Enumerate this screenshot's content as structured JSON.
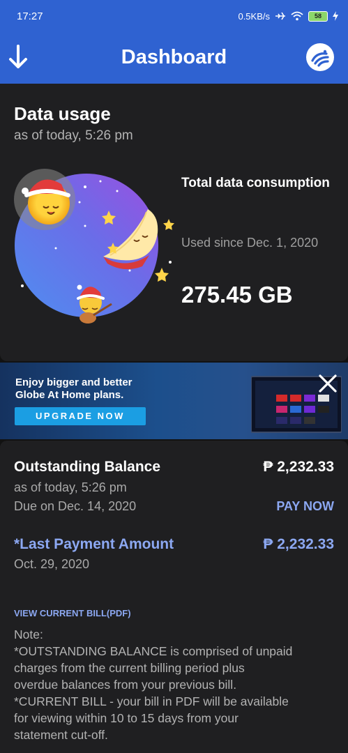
{
  "status_bar": {
    "time": "17:27",
    "network_speed": "0.5KB/s",
    "battery": "58"
  },
  "header": {
    "title": "Dashboard",
    "back_icon": "arrow-down-icon",
    "logo_icon": "globe-logo-icon"
  },
  "data_usage": {
    "title": "Data usage",
    "as_of": "as of today, 5:26 pm",
    "consumption_label": "Total data consumption",
    "used_since": "Used since Dec. 1, 2020",
    "total": "275.45 GB"
  },
  "promo_banner": {
    "line1": "Enjoy bigger and better",
    "line2": "Globe At Home plans.",
    "button_label": "UPGRADE NOW",
    "close_icon": "close-icon"
  },
  "billing": {
    "outstanding_label": "Outstanding Balance",
    "outstanding_amount": "₱ 2,232.33",
    "as_of": "as of today, 5:26 pm",
    "due_on": "Due on Dec. 14, 2020",
    "pay_now_label": "PAY NOW",
    "last_payment_label": "*Last Payment Amount",
    "last_payment_amount": "₱ 2,232.33",
    "last_payment_date": "Oct. 29, 2020",
    "view_bill_label": "VIEW CURRENT BILL(PDF)",
    "note_lines": [
      "Note:",
      "*OUTSTANDING BALANCE is comprised of unpaid",
      "charges from the current billing period plus",
      "overdue balances from your previous bill.",
      "*CURRENT BILL - your bill in PDF will be available",
      "for viewing within 10 to 15 days from your",
      "statement cut-off."
    ]
  },
  "colors": {
    "app_bar": "#2f62d1",
    "background": "#121212",
    "card": "#1f1f21",
    "link": "#8ca8f2",
    "upgrade_button": "#1b9ee3"
  }
}
